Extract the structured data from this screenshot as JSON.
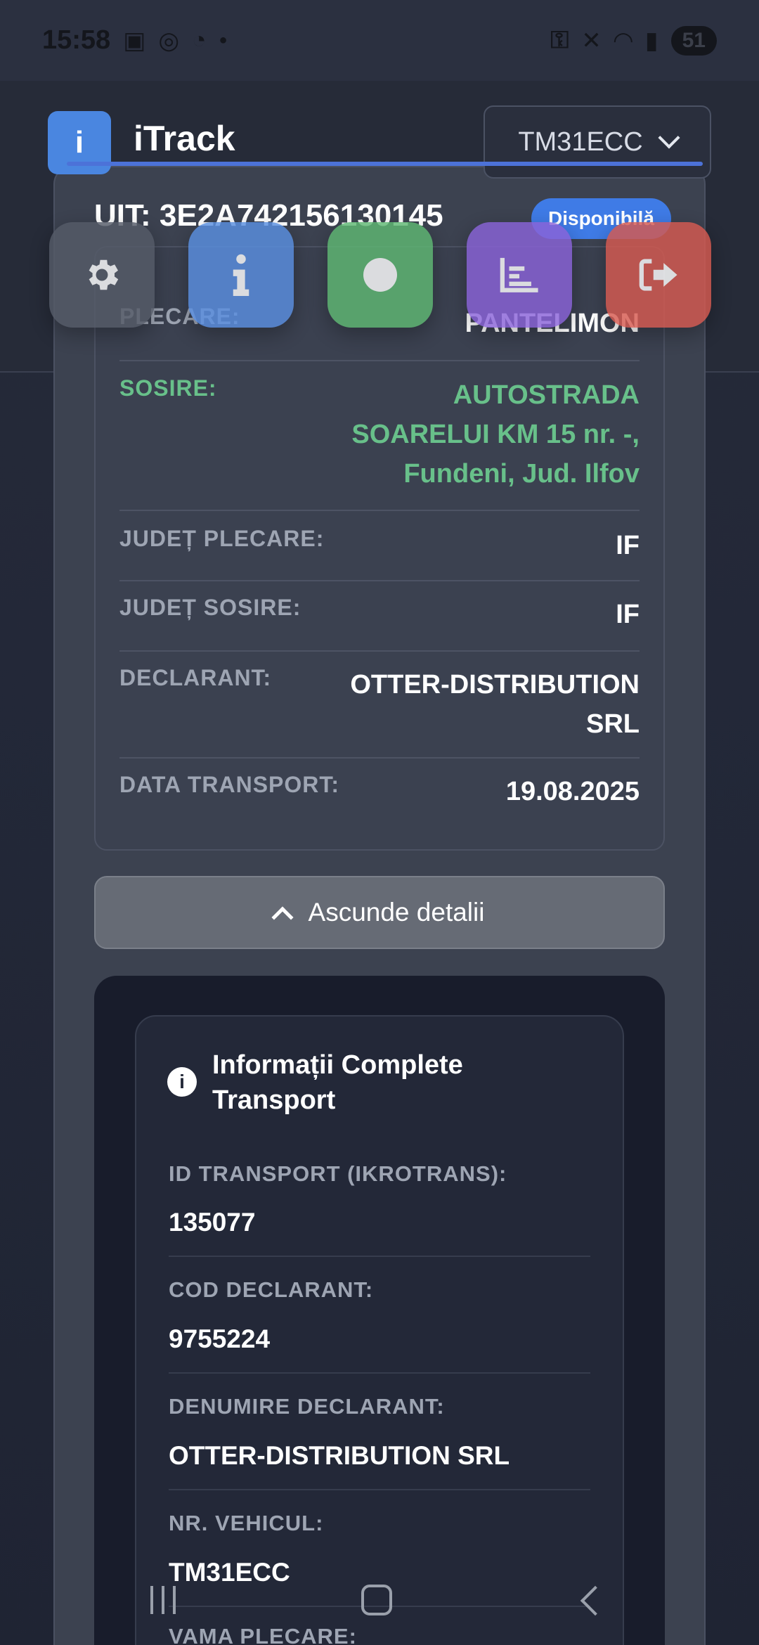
{
  "status_bar": {
    "time": "15:58",
    "battery": "51"
  },
  "header": {
    "logo_letter": "i",
    "app_title": "iTrack",
    "vehicle_selected": "TM31ECC"
  },
  "uit": "UIT: 3E2A742156130145",
  "status_badge": "Disponibilă",
  "details": {
    "plecare": {
      "label": "PLECARE:",
      "value": "PANTELIMON"
    },
    "sosire": {
      "label": "SOSIRE:",
      "value_lines": [
        "AUTOSTRADA",
        "SOARELUI KM 15 nr. -,",
        "Fundeni, Jud. Ilfov"
      ]
    },
    "judet_plecare": {
      "label": "JUDEȚ PLECARE:",
      "value": "IF"
    },
    "judet_sosire": {
      "label": "JUDEȚ SOSIRE:",
      "value": "IF"
    },
    "declarant": {
      "label": "DECLARANT:",
      "value_lines": [
        "OTTER-DISTRIBUTION",
        "SRL"
      ]
    },
    "data_transport": {
      "label": "DATA TRANSPORT:",
      "value": "19.08.2025"
    }
  },
  "toggle_label": "Ascunde detalii",
  "info": {
    "title": "Informații Complete Transport",
    "fields": [
      {
        "label": "ID TRANSPORT (IKROTRANS):",
        "value": "135077"
      },
      {
        "label": "COD DECLARANT:",
        "value": "9755224"
      },
      {
        "label": "DENUMIRE DECLARANT:",
        "value": "OTTER-DISTRIBUTION SRL"
      },
      {
        "label": "NR. VEHICUL:",
        "value": "TM31ECC"
      },
      {
        "label": "VAMA PLECARE:",
        "value": ""
      }
    ]
  },
  "colors": {
    "accent": "#4c72d8",
    "badge": "#3f7be6",
    "arrival_green": "#68c08a",
    "settings": "#555b68",
    "info": "#5a8fe0",
    "record": "#5fb873",
    "stats": "#8a63d8",
    "logout": "#d65a50"
  },
  "icons": [
    "settings-gear-icon",
    "info-icon",
    "record-dot-icon",
    "chart-icon",
    "logout-icon"
  ]
}
